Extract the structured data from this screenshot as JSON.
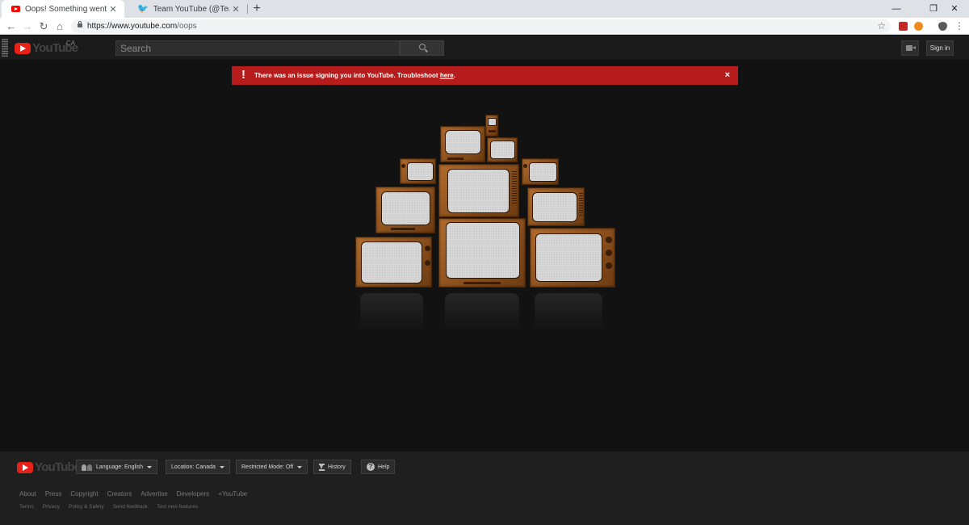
{
  "browser": {
    "tabs": [
      {
        "title": "Oops! Something went wrong. -",
        "close": "✕",
        "favicon": "youtube-favicon"
      },
      {
        "title": "Team YouTube (@TeamYouTube)",
        "close": "✕",
        "favicon": "twitter-favicon"
      }
    ],
    "new_tab": "+",
    "window_controls": {
      "minimize": "—",
      "restore": "❐",
      "close": "✕"
    },
    "nav": {
      "back": "←",
      "forward": "→",
      "reload": "↻",
      "home": "⌂"
    },
    "address": {
      "host": "https://www.youtube.com",
      "path": "/oops"
    },
    "bookmark": "☆"
  },
  "masthead": {
    "logo_text": "YouTube",
    "country": "CA",
    "search_placeholder": "Search",
    "search_value": "",
    "signin": "Sign in"
  },
  "alert": {
    "icon": "!",
    "message": "There was an issue signing you into YouTube. Troubleshoot ",
    "link": "here",
    "period": ".",
    "close": "×",
    "color": "#b71c1c"
  },
  "footer": {
    "logo_text": "YouTube",
    "language": "Language: English",
    "location": "Location: Canada",
    "restricted": "Restricted Mode: Off",
    "history": "History",
    "help": "Help",
    "links": [
      "About",
      "Press",
      "Copyright",
      "Creators",
      "Advertise",
      "Developers",
      "+YouTube"
    ],
    "sublinks": [
      "Terms",
      "Privacy",
      "Policy & Safety",
      "Send feedback",
      "Test new features"
    ]
  },
  "colors": {
    "brand_red": "#e62117",
    "page_bg": "#121212",
    "tv_wood": "#8a4f1c"
  }
}
